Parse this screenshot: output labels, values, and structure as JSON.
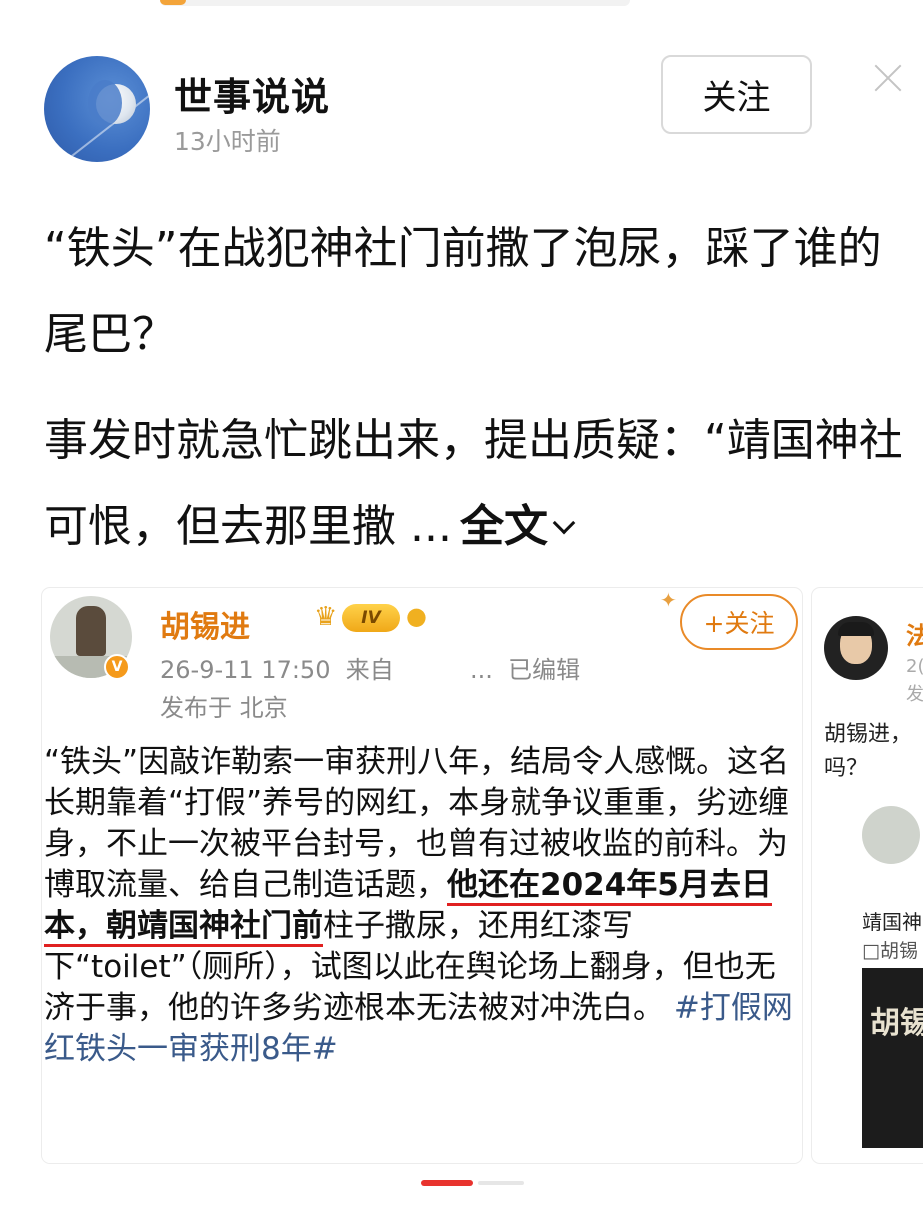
{
  "header": {
    "author": "世事说说",
    "time": "13小时前",
    "follow_label": "关注"
  },
  "post": {
    "headline": "“铁头”在战犯神社门前撒了泡尿，踩了谁的尾巴？",
    "excerpt": "事发时就急忙跳出来，提出质疑：“靖国神社可恨，但去那里撒 ...",
    "read_more": "全文"
  },
  "embedded_card": {
    "author": "胡锡进",
    "level": "IV",
    "verified_badge": "V",
    "follow_label": "+关注",
    "meta": "26-9-11 17:50  来自          ...  已编辑",
    "location": "发布于 北京",
    "text_before": "“铁头”因敲诈勒索一审获刑八年，结局令人感慨。这名长期靠着“打假”养号的网红，本身就争议重重，劣迹缠身，不止一次被平台封号，也曾有过被收监的前科。为博取流量、给自己制造话题，",
    "text_highlight": "他还在2024年5月去日本，朝靖国神社门前",
    "text_after": "柱子撒尿，还用红漆写下“toilet”（厕所），试图以此在舆论场上翻身，但也无济于事，他的许多劣迹根本无法被对冲洗白。",
    "hashtag": "#打假网红铁头一审获刑8年#"
  },
  "peek_card": {
    "name": "法",
    "meta1": "2(",
    "meta2": "发",
    "text": "胡锡进，吗？",
    "tag": "靖国神",
    "sub": "□胡锡",
    "video_text": "胡锡"
  },
  "pager": {
    "active_index": 0,
    "count": 2
  },
  "colors": {
    "accent_orange": "#e07a10",
    "highlight_red": "#e02020",
    "pager_red": "#e8332e",
    "hashtag_blue": "#3a5a8a"
  }
}
